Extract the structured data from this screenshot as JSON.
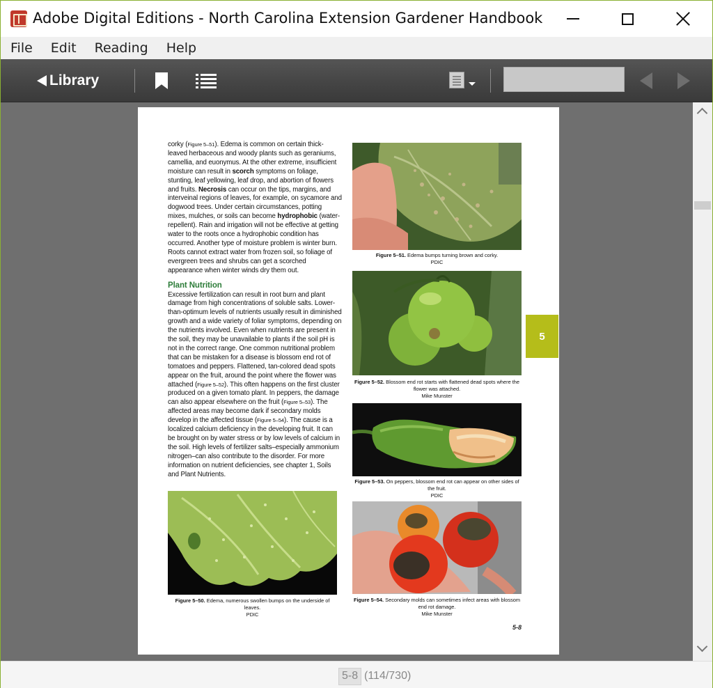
{
  "window": {
    "title": "Adobe Digital Editions - North Carolina Extension Gardener Handbook"
  },
  "menu": [
    "File",
    "Edit",
    "Reading",
    "Help"
  ],
  "toolbar": {
    "library_label": "Library",
    "search_value": ""
  },
  "page": {
    "chapter_tab": "5",
    "page_number": "5-8",
    "left_col_p1": [
      {
        "t": "corky ("
      },
      {
        "t": "Figure 5–51",
        "small": true
      },
      {
        "t": "). Edema is common on certain thick-leaved herbaceous and woody plants such as geraniums, camellia, and euonymus. At the other extreme, insufficient moisture can result in "
      },
      {
        "t": "scorch",
        "bold": true
      },
      {
        "t": " symptoms on foliage, stunting, leaf yellowing, leaf drop, and abortion of flowers and fruits. "
      },
      {
        "t": "Necrosis",
        "bold": true
      },
      {
        "t": " can occur on the tips, margins, and interveinal regions of leaves, for example, on sycamore and dogwood trees. Under certain circumstances, potting mixes, mulches, or soils can become "
      },
      {
        "t": "hydrophobic",
        "bold": true
      },
      {
        "t": " (water-repellent). Rain and irrigation will not be effective at getting water to the roots once a hydrophobic condition has occurred. Another type of moisture problem is winter burn. Roots cannot extract water from frozen soil, so foliage of evergreen trees and shrubs can get a scorched appearance when winter winds dry them out."
      }
    ],
    "section_heading": "Plant Nutrition",
    "left_col_p2": [
      {
        "t": "Excessive fertilization can result in root burn and plant damage from high concentrations of soluble salts. Lower-than-optimum levels of nutrients usually result in diminished growth and a wide variety of foliar symptoms, depending on the nutrients involved. Even when nutrients are present in the soil, they may be unavailable to plants if the soil pH is not in the correct range. One common nutritional problem that can be mistaken for a disease is blossom end rot of tomatoes and peppers. Flattened, tan-colored dead spots appear on the fruit, around the point where the flower was attached ("
      },
      {
        "t": "Figure 5–52",
        "small": true
      },
      {
        "t": "). This often happens on the first cluster produced on a given tomato plant. In peppers, the damage can also appear elsewhere on the fruit ("
      },
      {
        "t": "Figure 5–53",
        "small": true
      },
      {
        "t": "). The affected areas may become dark if secondary molds develop in the affected tissue ("
      },
      {
        "t": "Figure 5–54",
        "small": true
      },
      {
        "t": "). The cause is a localized calcium deficiency in the developing fruit. It can be brought on by water stress or by low levels of calcium in the soil. High levels of fertilizer salts–especially ammonium nitrogen–can also contribute to the disorder. For more information on nutrient deficiencies, see chapter 1, Soils and Plant Nutrients."
      }
    ],
    "figures": {
      "f51": {
        "label": "Figure 5–51.",
        "text": "Edema bumps turning brown and corky.",
        "credit": "PDIC"
      },
      "f52": {
        "label": "Figure 5–52.",
        "text": "Blossom end rot starts with flattened dead spots where the flower was attached.",
        "credit": "Mike Munster"
      },
      "f53": {
        "label": "Figure 5–53.",
        "text": "On peppers, blossom end rot can appear on other sides of the fruit.",
        "credit": "PDIC"
      },
      "f54": {
        "label": "Figure 5–54.",
        "text": "Secondary molds can sometimes infect areas with blossom end rot damage.",
        "credit": "Mike Munster"
      },
      "f50": {
        "label": "Figure 5–50.",
        "text": "Edema, numerous swollen bumps on the underside of leaves.",
        "credit": "PDIC"
      }
    }
  },
  "status": {
    "page": "5-8",
    "count": "(114/730)"
  }
}
